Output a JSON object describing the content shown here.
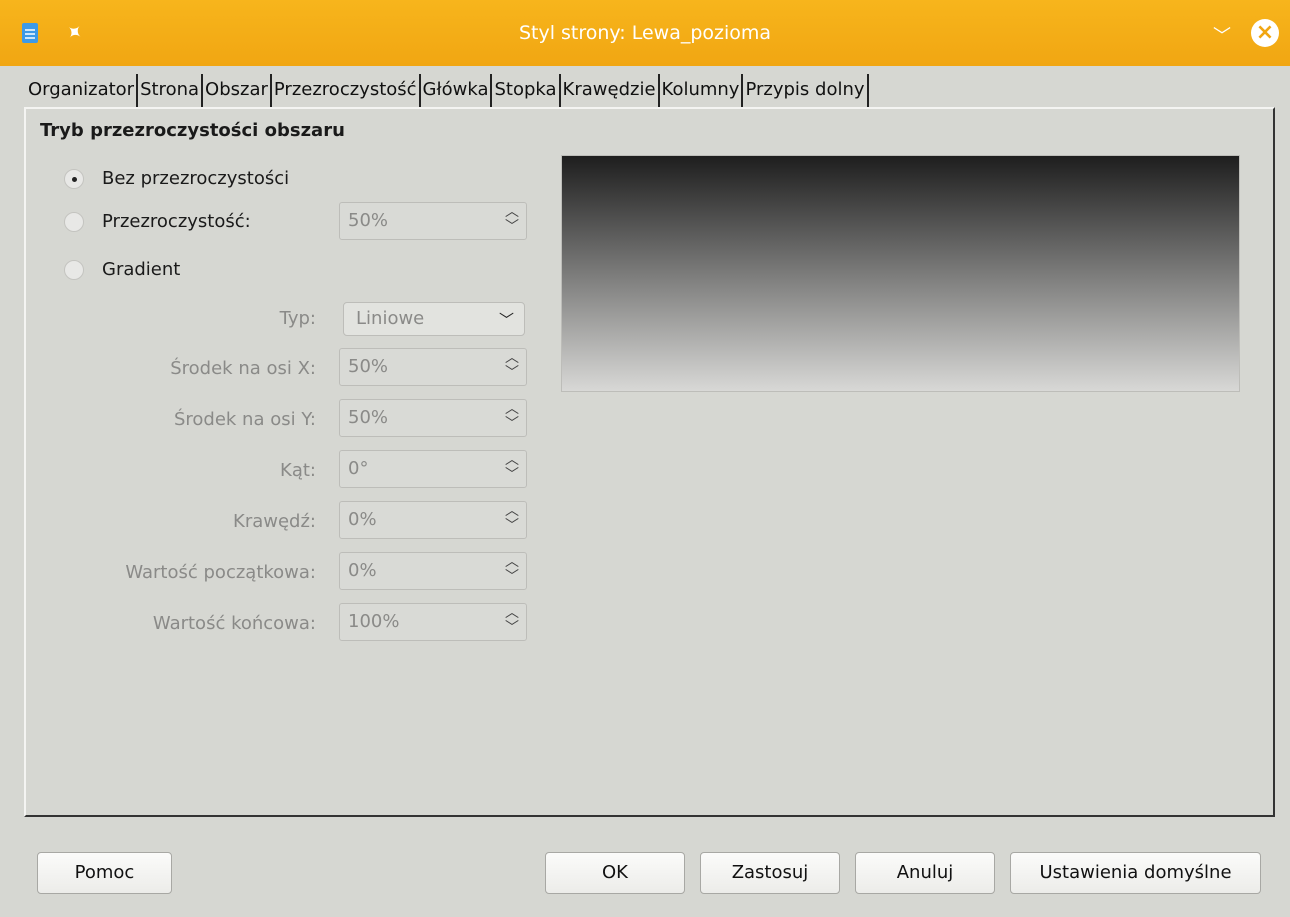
{
  "window": {
    "title": "Styl strony: Lewa_pozioma"
  },
  "tabs": [
    {
      "label": "Organizator"
    },
    {
      "label": "Strona"
    },
    {
      "label": "Obszar"
    },
    {
      "label": "Przezroczystość"
    },
    {
      "label": "Główka"
    },
    {
      "label": "Stopka"
    },
    {
      "label": "Krawędzie"
    },
    {
      "label": "Kolumny"
    },
    {
      "label": "Przypis dolny"
    }
  ],
  "active_tab": "Przezroczystość",
  "section": {
    "title": "Tryb przezroczystości obszaru"
  },
  "modes": {
    "none": {
      "label": "Bez przezroczystości",
      "checked": true
    },
    "transparency": {
      "label": "Przezroczystość:",
      "value": "50%"
    },
    "gradient": {
      "label": "Gradient"
    }
  },
  "gradient": {
    "type_label": "Typ:",
    "type_value": "Liniowe",
    "center_x_label": "Środek na osi X:",
    "center_x_value": "50%",
    "center_y_label": "Środek na osi Y:",
    "center_y_value": "50%",
    "angle_label": "Kąt:",
    "angle_value": "0°",
    "border_label": "Krawędź:",
    "border_value": "0%",
    "start_label": "Wartość początkowa:",
    "start_value": "0%",
    "end_label": "Wartość końcowa:",
    "end_value": "100%"
  },
  "buttons": {
    "help": "Pomoc",
    "ok": "OK",
    "apply": "Zastosuj",
    "cancel": "Anuluj",
    "reset": "Ustawienia domyślne"
  },
  "colors": {
    "titlebar": "#f1a612",
    "background": "#d6d7d2"
  },
  "icons": [
    "writer-app-icon",
    "pin-icon",
    "minimize-icon",
    "close-icon"
  ]
}
